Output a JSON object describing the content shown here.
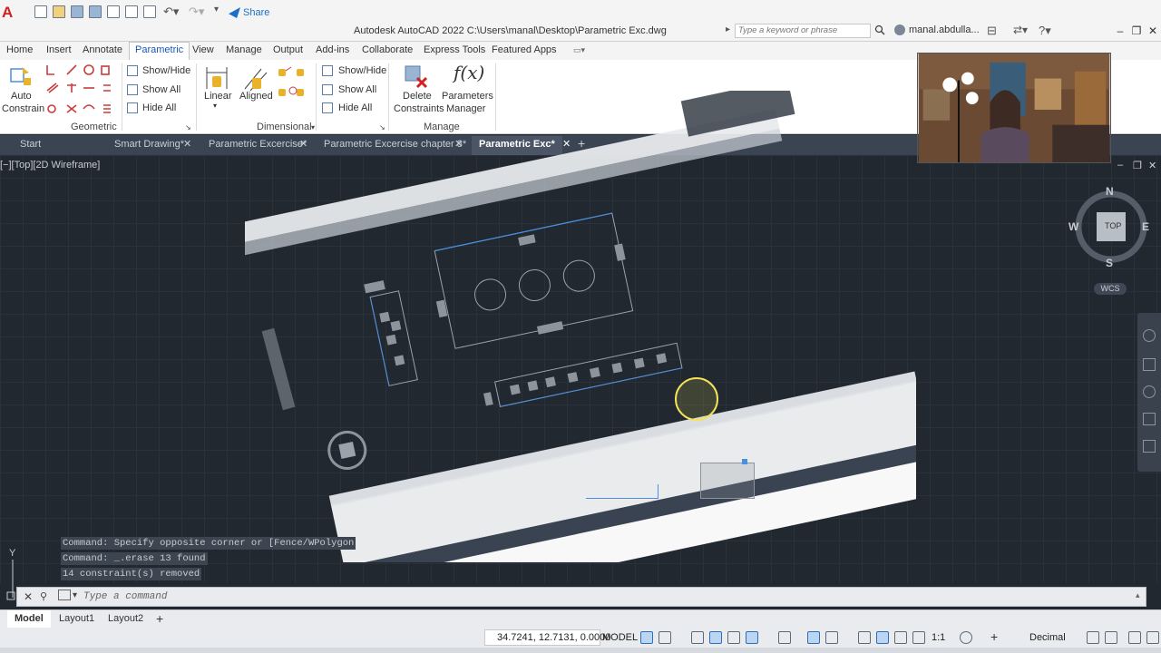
{
  "title_bar": {
    "app_title": "Autodesk AutoCAD 2022    C:\\Users\\manal\\Desktop\\Parametric Exc.dwg",
    "share_label": "Share",
    "search_placeholder": "Type a keyword or phrase",
    "user_name": "manal.abdulla..."
  },
  "ribbon_tabs": [
    "Home",
    "Insert",
    "Annotate",
    "Parametric",
    "View",
    "Manage",
    "Output",
    "Add-ins",
    "Collaborate",
    "Express Tools",
    "Featured Apps"
  ],
  "ribbon": {
    "auto_constrain_line1": "Auto",
    "auto_constrain_line2": "Constrain",
    "geo_show_hide": "Show/Hide",
    "geo_show_all": "Show All",
    "geo_hide_all": "Hide All",
    "geometric_label": "Geometric",
    "linear": "Linear",
    "aligned": "Aligned",
    "dim_show_hide": "Show/Hide",
    "dim_show_all": "Show All",
    "dim_hide_all": "Hide All",
    "dimensional_label": "Dimensional",
    "delete_line1": "Delete",
    "delete_line2": "Constraints",
    "params_line1": "Parameters",
    "params_line2": "Manager",
    "manage_label": "Manage"
  },
  "file_tabs": {
    "start": "Start",
    "tab1": "Smart Drawing*",
    "tab2": "Parametric Excercise*",
    "tab3": "Parametric Excercise chapter 8*",
    "tab4": "Parametric Exc*"
  },
  "viewport": {
    "label": "[−][Top][2D Wireframe]",
    "viewcube_top": "TOP",
    "viewcube_n": "N",
    "viewcube_s": "S",
    "viewcube_e": "E",
    "viewcube_w": "W",
    "wcs": "WCS"
  },
  "command": {
    "history": [
      "Command: Specify opposite corner or [Fence/WPolygon",
      "Command: _.erase 13 found",
      "14 constraint(s) removed"
    ],
    "input_placeholder": "Type a command"
  },
  "layout_tabs": [
    "Model",
    "Layout1",
    "Layout2"
  ],
  "status": {
    "coords": "34.7241, 12.7131, 0.0000",
    "model": "MODEL",
    "scale": "1:1",
    "units": "Decimal"
  },
  "colors": {
    "accent": "#1a58b0",
    "drawing_bg": "#212830",
    "selection_blue": "#4a8fe0",
    "cursor_highlight": "#f4e35a"
  }
}
